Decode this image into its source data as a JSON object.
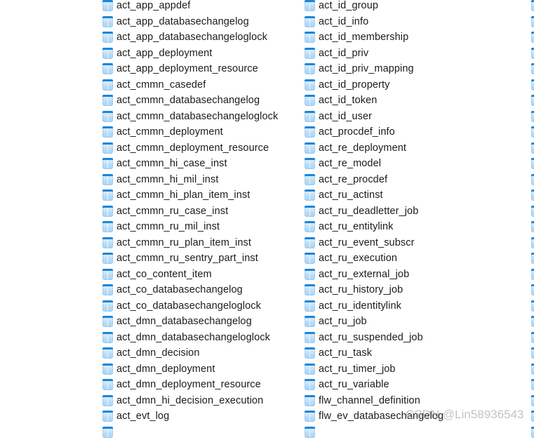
{
  "view": {
    "name": "database-table-list",
    "background_color": "#ffffff",
    "text_color": "#1b1b1b",
    "icon_header_color": "#1c86d8",
    "icon_body_color": "#cfe7fa",
    "icon_semantic_name": "database-table-icon"
  },
  "watermark": {
    "text": "CSDN @Lin58936543",
    "color": "#b4b4b4"
  },
  "columns": [
    {
      "id": "column-1",
      "items": [
        {
          "label": "act_app_appdef",
          "icon": "database-table-icon"
        },
        {
          "label": "act_app_databasechangelog",
          "icon": "database-table-icon"
        },
        {
          "label": "act_app_databasechangeloglock",
          "icon": "database-table-icon"
        },
        {
          "label": "act_app_deployment",
          "icon": "database-table-icon"
        },
        {
          "label": "act_app_deployment_resource",
          "icon": "database-table-icon"
        },
        {
          "label": "act_cmmn_casedef",
          "icon": "database-table-icon"
        },
        {
          "label": "act_cmmn_databasechangelog",
          "icon": "database-table-icon"
        },
        {
          "label": "act_cmmn_databasechangeloglock",
          "icon": "database-table-icon"
        },
        {
          "label": "act_cmmn_deployment",
          "icon": "database-table-icon"
        },
        {
          "label": "act_cmmn_deployment_resource",
          "icon": "database-table-icon"
        },
        {
          "label": "act_cmmn_hi_case_inst",
          "icon": "database-table-icon"
        },
        {
          "label": "act_cmmn_hi_mil_inst",
          "icon": "database-table-icon"
        },
        {
          "label": "act_cmmn_hi_plan_item_inst",
          "icon": "database-table-icon"
        },
        {
          "label": "act_cmmn_ru_case_inst",
          "icon": "database-table-icon"
        },
        {
          "label": "act_cmmn_ru_mil_inst",
          "icon": "database-table-icon"
        },
        {
          "label": "act_cmmn_ru_plan_item_inst",
          "icon": "database-table-icon"
        },
        {
          "label": "act_cmmn_ru_sentry_part_inst",
          "icon": "database-table-icon"
        },
        {
          "label": "act_co_content_item",
          "icon": "database-table-icon"
        },
        {
          "label": "act_co_databasechangelog",
          "icon": "database-table-icon"
        },
        {
          "label": "act_co_databasechangeloglock",
          "icon": "database-table-icon"
        },
        {
          "label": "act_dmn_databasechangelog",
          "icon": "database-table-icon"
        },
        {
          "label": "act_dmn_databasechangeloglock",
          "icon": "database-table-icon"
        },
        {
          "label": "act_dmn_decision",
          "icon": "database-table-icon"
        },
        {
          "label": "act_dmn_deployment",
          "icon": "database-table-icon"
        },
        {
          "label": "act_dmn_deployment_resource",
          "icon": "database-table-icon"
        },
        {
          "label": "act_dmn_hi_decision_execution",
          "icon": "database-table-icon"
        },
        {
          "label": "act_evt_log",
          "icon": "database-table-icon"
        },
        {
          "label": "",
          "icon": "database-table-icon"
        }
      ]
    },
    {
      "id": "column-2",
      "items": [
        {
          "label": "act_id_group",
          "icon": "database-table-icon"
        },
        {
          "label": "act_id_info",
          "icon": "database-table-icon"
        },
        {
          "label": "act_id_membership",
          "icon": "database-table-icon"
        },
        {
          "label": "act_id_priv",
          "icon": "database-table-icon"
        },
        {
          "label": "act_id_priv_mapping",
          "icon": "database-table-icon"
        },
        {
          "label": "act_id_property",
          "icon": "database-table-icon"
        },
        {
          "label": "act_id_token",
          "icon": "database-table-icon"
        },
        {
          "label": "act_id_user",
          "icon": "database-table-icon"
        },
        {
          "label": "act_procdef_info",
          "icon": "database-table-icon"
        },
        {
          "label": "act_re_deployment",
          "icon": "database-table-icon"
        },
        {
          "label": "act_re_model",
          "icon": "database-table-icon"
        },
        {
          "label": "act_re_procdef",
          "icon": "database-table-icon"
        },
        {
          "label": "act_ru_actinst",
          "icon": "database-table-icon"
        },
        {
          "label": "act_ru_deadletter_job",
          "icon": "database-table-icon"
        },
        {
          "label": "act_ru_entitylink",
          "icon": "database-table-icon"
        },
        {
          "label": "act_ru_event_subscr",
          "icon": "database-table-icon"
        },
        {
          "label": "act_ru_execution",
          "icon": "database-table-icon"
        },
        {
          "label": "act_ru_external_job",
          "icon": "database-table-icon"
        },
        {
          "label": "act_ru_history_job",
          "icon": "database-table-icon"
        },
        {
          "label": "act_ru_identitylink",
          "icon": "database-table-icon"
        },
        {
          "label": "act_ru_job",
          "icon": "database-table-icon"
        },
        {
          "label": "act_ru_suspended_job",
          "icon": "database-table-icon"
        },
        {
          "label": "act_ru_task",
          "icon": "database-table-icon"
        },
        {
          "label": "act_ru_timer_job",
          "icon": "database-table-icon"
        },
        {
          "label": "act_ru_variable",
          "icon": "database-table-icon"
        },
        {
          "label": "flw_channel_definition",
          "icon": "database-table-icon"
        },
        {
          "label": "flw_ev_databasechangelog",
          "icon": "database-table-icon"
        },
        {
          "label": "",
          "icon": "database-table-icon"
        }
      ]
    },
    {
      "id": "column-3",
      "items": [
        {
          "label": "",
          "icon": "database-table-icon"
        },
        {
          "label": "",
          "icon": "database-table-icon"
        },
        {
          "label": "",
          "icon": "database-table-icon"
        },
        {
          "label": "",
          "icon": "database-table-icon"
        },
        {
          "label": "",
          "icon": "database-table-icon"
        },
        {
          "label": "",
          "icon": "database-table-icon"
        },
        {
          "label": "",
          "icon": "database-table-icon"
        },
        {
          "label": "",
          "icon": "database-table-icon"
        },
        {
          "label": "",
          "icon": "database-table-icon"
        },
        {
          "label": "",
          "icon": "database-table-icon"
        },
        {
          "label": "",
          "icon": "database-table-icon"
        },
        {
          "label": "",
          "icon": "database-table-icon"
        },
        {
          "label": "",
          "icon": "database-table-icon"
        },
        {
          "label": "",
          "icon": "database-table-icon"
        },
        {
          "label": "",
          "icon": "database-table-icon"
        },
        {
          "label": "",
          "icon": "database-table-icon"
        },
        {
          "label": "",
          "icon": "database-table-icon"
        },
        {
          "label": "",
          "icon": "database-table-icon"
        },
        {
          "label": "",
          "icon": "database-table-icon"
        },
        {
          "label": "",
          "icon": "database-table-icon"
        },
        {
          "label": "",
          "icon": "database-table-icon"
        },
        {
          "label": "",
          "icon": "database-table-icon"
        },
        {
          "label": "",
          "icon": "database-table-icon"
        },
        {
          "label": "",
          "icon": "database-table-icon"
        },
        {
          "label": "",
          "icon": "database-table-icon"
        },
        {
          "label": "",
          "icon": "database-table-icon"
        },
        {
          "label": "",
          "icon": "database-table-icon"
        },
        {
          "label": "",
          "icon": "database-table-icon"
        }
      ]
    }
  ]
}
